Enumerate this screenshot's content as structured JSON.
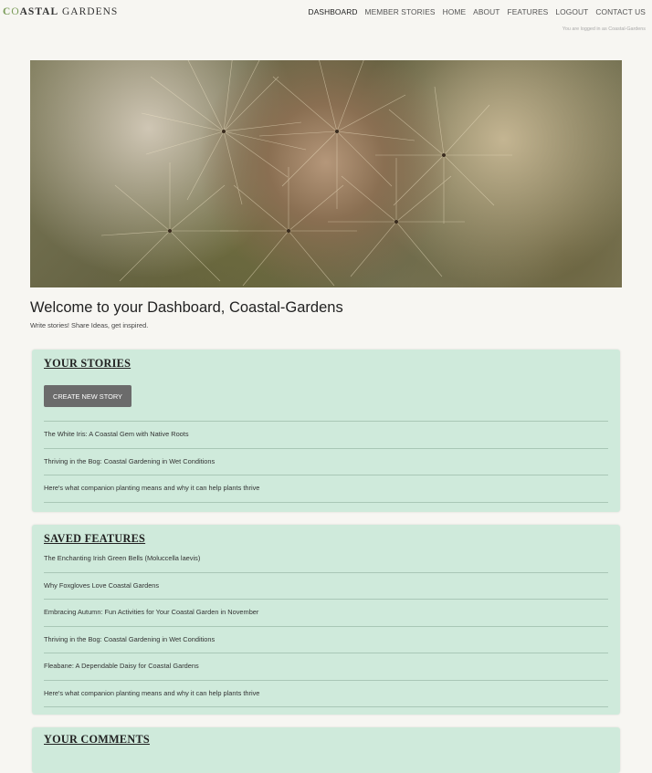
{
  "header": {
    "logo": {
      "first": "C",
      "o": "O",
      "rest": "ASTAL",
      "second": "GARDENS"
    },
    "nav": [
      "DASHBOARD",
      "MEMBER STORIES",
      "HOME",
      "ABOUT",
      "FEATURES",
      "LOGOUT",
      "CONTACT US"
    ],
    "active_nav": "DASHBOARD",
    "logged_in_text": "You are logged in as Coastal-Gardens"
  },
  "hero": {
    "image": "dandelion-seedhead-closeup"
  },
  "welcome": {
    "title": "Welcome to your Dashboard, Coastal-Gardens",
    "subtitle": "Write stories! Share Ideas, get inspired."
  },
  "stories": {
    "heading": "YOUR STORIES",
    "create_button": "CREATE NEW STORY",
    "items": [
      "The White Iris: A Coastal Gem with Native Roots",
      "Thriving in the Bog: Coastal Gardening in Wet Conditions",
      "Here's what companion planting means and why it can help plants thrive"
    ]
  },
  "saved": {
    "heading": "SAVED FEATURES",
    "items": [
      "The Enchanting Irish Green Bells (Moluccella laevis)",
      "Why Foxgloves Love Coastal Gardens",
      "Embracing Autumn: Fun Activities for Your Coastal Garden in November",
      "Thriving in the Bog: Coastal Gardening in Wet Conditions",
      "Fleabane: A Dependable Daisy for Coastal Gardens",
      "Here's what companion planting means and why it can help plants thrive"
    ]
  },
  "comments": {
    "heading": "YOUR COMMENTS"
  },
  "colors": {
    "panel": "#cfeadb",
    "background": "#f7f6f2",
    "button": "#6b6b6b",
    "logo_accent": "#7a9c59"
  }
}
